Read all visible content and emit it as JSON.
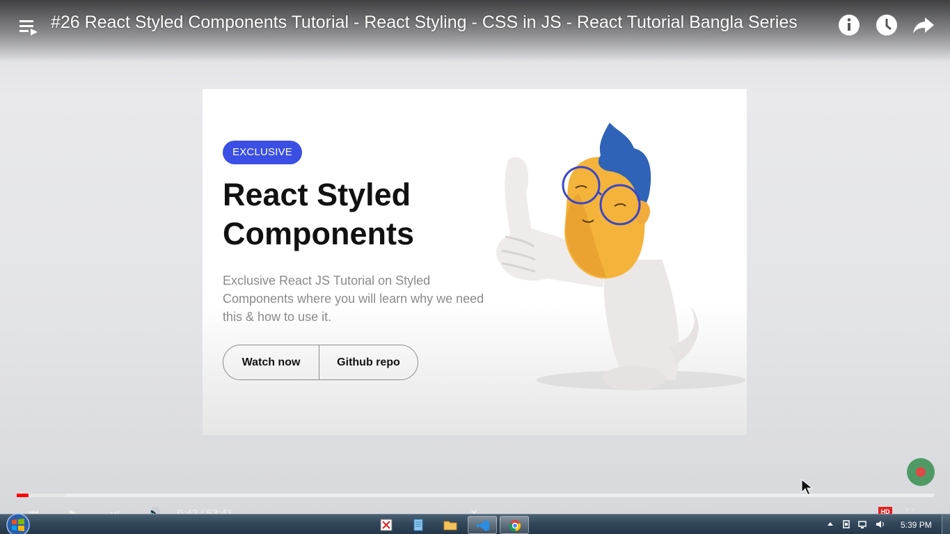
{
  "player": {
    "title": "#26 React Styled Components Tutorial - React Styling - CSS in JS - React Tutorial Bangla Series",
    "progress_fraction": 0.013,
    "buffered_fraction": 0.053,
    "time_display": "0:42 / 53:41"
  },
  "slide": {
    "badge": "EXCLUSIVE",
    "title": "React Styled Components",
    "description": "Exclusive React JS Tutorial on Styled Components where you will learn why we need this & how to use it.",
    "buttons": {
      "watch": "Watch now",
      "github": "Github repo"
    }
  },
  "taskbar": {
    "clock": "5:39 PM"
  },
  "colors": {
    "accent": "#3b4fe4",
    "progress": "#ff0000",
    "record": "#4f9a64"
  },
  "icons": [
    "playlist-icon",
    "info-icon",
    "clock-icon",
    "share-icon",
    "windows-start-icon",
    "snipping-tool-icon",
    "notepad-icon",
    "file-explorer-icon",
    "vscode-icon",
    "chrome-icon"
  ]
}
